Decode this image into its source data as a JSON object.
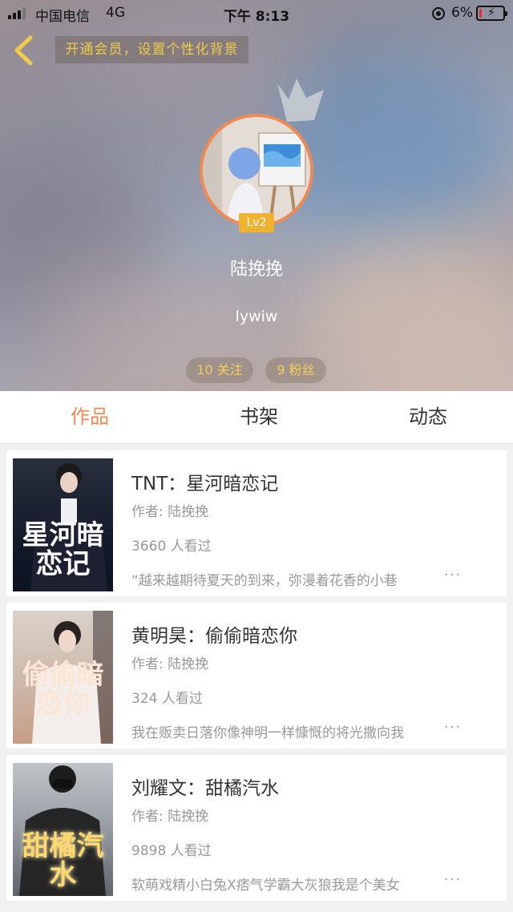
{
  "status_bar": {
    "carrier": "中国电信",
    "network": "4G",
    "time": "下午 8:13",
    "battery_percent": "6%",
    "battery_level": 0.06
  },
  "header": {
    "vip_banner": "开通会员，设置个性化背景",
    "level": "Lv2",
    "nickname": "陆挽挽",
    "user_id": "lywiw",
    "following": "10 关注",
    "fans": "9 粉丝"
  },
  "tabs": [
    {
      "label": "作品",
      "active": true
    },
    {
      "label": "书架",
      "active": false
    },
    {
      "label": "动态",
      "active": false
    }
  ],
  "colors": {
    "accent": "#ef8a55",
    "gold": "#f0cb47",
    "text_primary": "#333333",
    "text_secondary": "#999999"
  },
  "works": [
    {
      "title": "TNT：星河暗恋记",
      "author": "作者: 陆挽挽",
      "views": "3660 人看过",
      "description": "“越来越期待夏天的到来，弥漫着花香的小巷",
      "more": "···",
      "cover_text": "星河暗恋记"
    },
    {
      "title": "黄明昊：偷偷暗恋你",
      "author": "作者: 陆挽挽",
      "views": "324 人看过",
      "description": "我在贩卖日落你像神明一样慷慨的将光撒向我",
      "more": "···",
      "cover_text": "偷偷暗恋你"
    },
    {
      "title": "刘耀文：甜橘汽水",
      "author": "作者: 陆挽挽",
      "views": "9898 人看过",
      "description": "软萌戏精小白兔Ⅹ痞气学霸大灰狼我是个美女",
      "more": "···",
      "cover_text": "甜橘汽水"
    }
  ]
}
